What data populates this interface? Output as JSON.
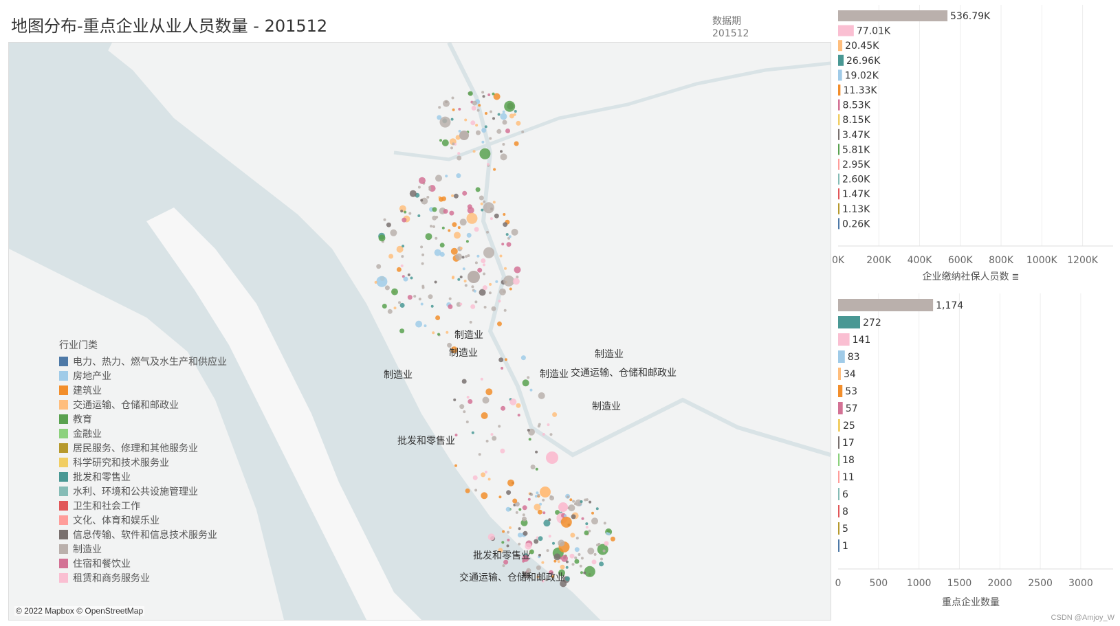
{
  "title": "地图分布-重点企业从业人员数量 - 201512",
  "period": {
    "label": "数据期",
    "value": "201512"
  },
  "map": {
    "attribution": "© 2022 Mapbox © OpenStreetMap",
    "labels": [
      {
        "text": "制造业"
      },
      {
        "text": "制造业"
      },
      {
        "text": "制造业"
      },
      {
        "text": "制造业"
      },
      {
        "text": "交通运输、仓储和邮政业"
      },
      {
        "text": "制造业"
      },
      {
        "text": "制造业"
      },
      {
        "text": "批发和零售业"
      },
      {
        "text": "批发和零售业"
      },
      {
        "text": "交通运输、仓储和邮政业"
      }
    ]
  },
  "legend": {
    "title": "行业门类",
    "items": [
      {
        "label": "电力、热力、燃气及水生产和供应业",
        "color": "#4e79a7"
      },
      {
        "label": "房地产业",
        "color": "#a0cbe8"
      },
      {
        "label": "建筑业",
        "color": "#f28e2b"
      },
      {
        "label": "交通运输、仓储和邮政业",
        "color": "#ffbe7d"
      },
      {
        "label": "教育",
        "color": "#59a14f"
      },
      {
        "label": "金融业",
        "color": "#8cd17d"
      },
      {
        "label": "居民服务、修理和其他服务业",
        "color": "#b6992d"
      },
      {
        "label": "科学研究和技术服务业",
        "color": "#f1ce63"
      },
      {
        "label": "批发和零售业",
        "color": "#499894"
      },
      {
        "label": "水利、环境和公共设施管理业",
        "color": "#86bcb6"
      },
      {
        "label": "卫生和社会工作",
        "color": "#e15759"
      },
      {
        "label": "文化、体育和娱乐业",
        "color": "#ff9d9a"
      },
      {
        "label": "信息传输、软件和信息技术服务业",
        "color": "#79706e"
      },
      {
        "label": "制造业",
        "color": "#bab0ac"
      },
      {
        "label": "住宿和餐饮业",
        "color": "#d37295"
      },
      {
        "label": "租赁和商务服务业",
        "color": "#fabfd2"
      }
    ]
  },
  "chart_data": [
    {
      "type": "bar",
      "orientation": "horizontal",
      "xlabel": "企业缴纳社保人员数",
      "xlim": [
        0,
        1350000
      ],
      "ticks": [
        0,
        200000,
        400000,
        600000,
        800000,
        1000000,
        1200000
      ],
      "tick_labels": [
        "0K",
        "200K",
        "400K",
        "600K",
        "800K",
        "1000K",
        "1200K"
      ],
      "categories": [
        "制造业",
        "租赁和商务服务业",
        "交通运输、仓储和邮政业",
        "批发和零售业",
        "房地产业",
        "建筑业",
        "住宿和餐饮业",
        "科学研究和技术服务业",
        "信息传输、软件和信息技术服务业",
        "金融业",
        "文化、体育和娱乐业",
        "水利、环境和公共设施管理业",
        "卫生和社会工作",
        "居民服务、修理和其他服务业",
        "电力、热力、燃气及水生产和供应业"
      ],
      "values": [
        536790,
        77010,
        20450,
        26960,
        19020,
        11330,
        8530,
        8150,
        3470,
        5810,
        2950,
        2600,
        1470,
        1130,
        260
      ],
      "value_labels": [
        "536.79K",
        "77.01K",
        "20.45K",
        "26.96K",
        "19.02K",
        "11.33K",
        "8.53K",
        "8.15K",
        "3.47K",
        "5.81K",
        "2.95K",
        "2.60K",
        "1.47K",
        "1.13K",
        "0.26K"
      ],
      "colors": [
        "#bab0ac",
        "#fabfd2",
        "#ffbe7d",
        "#499894",
        "#a0cbe8",
        "#f28e2b",
        "#d37295",
        "#f1ce63",
        "#79706e",
        "#59a14f",
        "#ff9d9a",
        "#86bcb6",
        "#e15759",
        "#b6992d",
        "#4e79a7"
      ]
    },
    {
      "type": "bar",
      "orientation": "horizontal",
      "xlabel": "重点企业数量",
      "xlim": [
        0,
        3400
      ],
      "ticks": [
        0,
        500,
        1000,
        1500,
        2000,
        2500,
        3000
      ],
      "tick_labels": [
        "0",
        "500",
        "1000",
        "1500",
        "2000",
        "2500",
        "3000"
      ],
      "categories": [
        "制造业",
        "批发和零售业",
        "租赁和商务服务业",
        "房地产业",
        "交通运输、仓储和邮政业",
        "建筑业",
        "住宿和餐饮业",
        "科学研究和技术服务业",
        "信息传输、软件和信息技术服务业",
        "金融业",
        "文化、体育和娱乐业",
        "水利、环境和公共设施管理业",
        "卫生和社会工作",
        "居民服务、修理和其他服务业",
        "电力、热力、燃气及水生产和供应业"
      ],
      "values": [
        1174,
        272,
        141,
        83,
        34,
        53,
        57,
        25,
        17,
        18,
        11,
        6,
        8,
        5,
        1
      ],
      "value_labels": [
        "1,174",
        "272",
        "141",
        "83",
        "34",
        "53",
        "57",
        "25",
        "17",
        "18",
        "11",
        "6",
        "8",
        "5",
        "1"
      ],
      "colors": [
        "#bab0ac",
        "#499894",
        "#fabfd2",
        "#a0cbe8",
        "#ffbe7d",
        "#f28e2b",
        "#d37295",
        "#f1ce63",
        "#79706e",
        "#8cd17d",
        "#ff9d9a",
        "#86bcb6",
        "#e15759",
        "#b6992d",
        "#4e79a7"
      ]
    }
  ],
  "footer": "CSDN @Amjoy_W"
}
